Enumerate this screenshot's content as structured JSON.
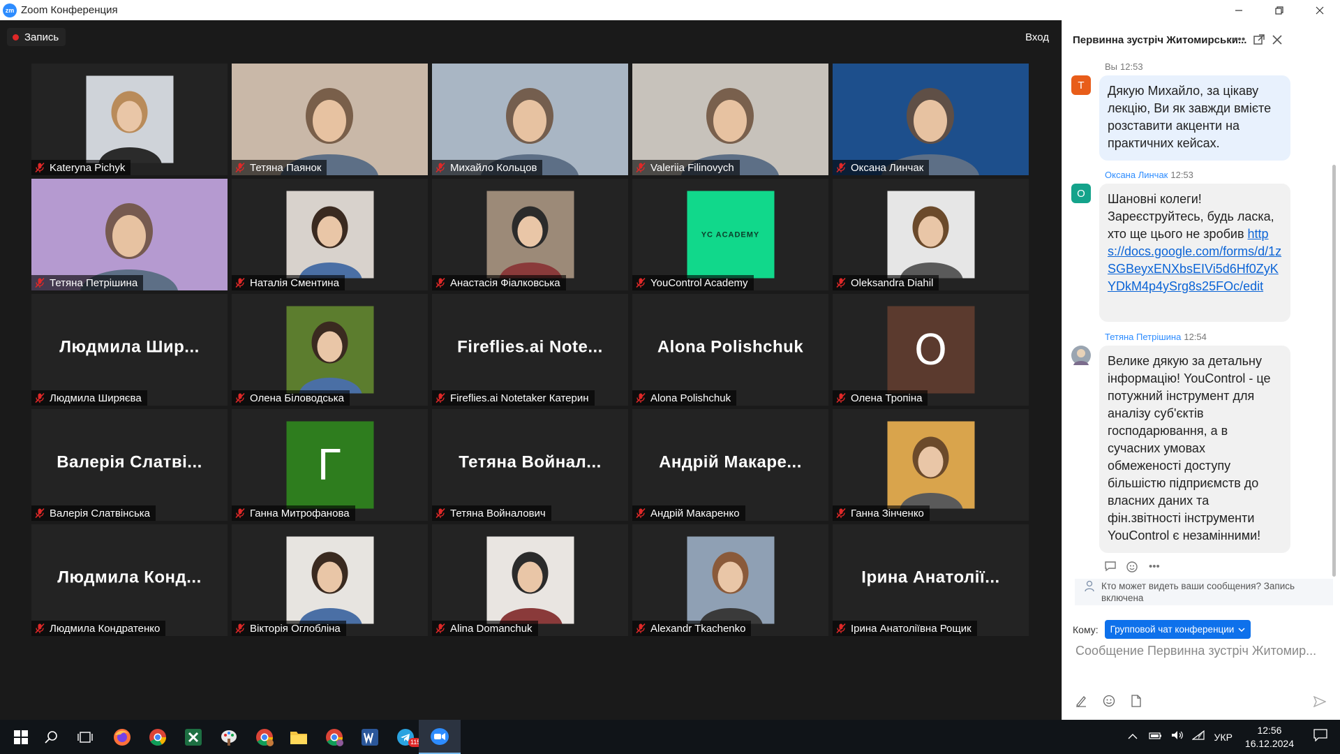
{
  "window": {
    "title": "Zoom Конференция",
    "logo_text": "zm"
  },
  "meeting": {
    "record_label": "Запись",
    "exit_label": "Вход"
  },
  "participants": [
    {
      "name": "Kateryna Pichyk",
      "kind": "photo",
      "bg": "#cfd3d9"
    },
    {
      "name": "Тетяна Паянок",
      "kind": "video",
      "bg": "#c9b8a8"
    },
    {
      "name": "Михайло Кольцов",
      "kind": "video",
      "bg": "#a9b6c4",
      "active": true
    },
    {
      "name": "Valeriia Filinovych",
      "kind": "video",
      "bg": "#c7c2bb"
    },
    {
      "name": "Оксана Линчак",
      "kind": "video",
      "bg": "#1d4f8c"
    },
    {
      "name": "Тетяна Петрішина",
      "kind": "video",
      "bg": "#b59ad0"
    },
    {
      "name": "Наталія Сментина",
      "kind": "photo",
      "bg": "#d8d2cc"
    },
    {
      "name": "Анастасія Фіалковська",
      "kind": "photo",
      "bg": "#9c8a78"
    },
    {
      "name": "YouControl Academy",
      "kind": "logo",
      "bg": "#11d88b",
      "logo_text": "YC ACADEMY"
    },
    {
      "name": "Oleksandra Diahil",
      "kind": "photo",
      "bg": "#e6e6e6"
    },
    {
      "name": "Людмила Ширяєва",
      "kind": "name",
      "display": "Людмила Шир..."
    },
    {
      "name": "Олена Біловодська",
      "kind": "photo",
      "bg": "#5c7d2e"
    },
    {
      "name": "Fireflies.ai Notetaker Катерин",
      "kind": "name",
      "display": "Fireflies.ai Note..."
    },
    {
      "name": "Alona Polishchuk",
      "kind": "name",
      "display": "Alona Polishchuk"
    },
    {
      "name": "Олена Тропіна",
      "kind": "letter",
      "bg": "#5b3a2e",
      "letter": "О"
    },
    {
      "name": "Валерія Слатвінська",
      "kind": "name",
      "display": "Валерія Слатві..."
    },
    {
      "name": "Ганна Митрофанова",
      "kind": "letter",
      "bg": "#2e7d1e",
      "letter": "Г"
    },
    {
      "name": "Тетяна Войналович",
      "kind": "name",
      "display": "Тетяна Войнал..."
    },
    {
      "name": "Андрій Макаренко",
      "kind": "name",
      "display": "Андрій Макаре..."
    },
    {
      "name": "Ганна Зінченко",
      "kind": "photo",
      "bg": "#d9a44c"
    },
    {
      "name": "Людмила Кондратенко",
      "kind": "name",
      "display": "Людмила Конд..."
    },
    {
      "name": "Вікторія Оглобліна",
      "kind": "photo",
      "bg": "#e7e4e0"
    },
    {
      "name": "Alina Domanchuk",
      "kind": "photo",
      "bg": "#e9e5e1"
    },
    {
      "name": "Alexandr Tkachenko",
      "kind": "photo",
      "bg": "#8fa0b4"
    },
    {
      "name": "Ірина Анатоліївна Рощик",
      "kind": "name",
      "display": "Ірина Анатолії..."
    }
  ],
  "chat": {
    "title": "Первинна зустріч Житомирськи...",
    "messages": [
      {
        "sender": "Вы",
        "time": "12:53",
        "avatar": "T",
        "avatar_color": "#e85d1a",
        "self": true,
        "text": "Дякую Михайло, за цікаву лекцію, Ви як завжди вмієте розставити акценти на практичних кейсах."
      },
      {
        "sender": "Оксана Линчак",
        "time": "12:53",
        "avatar": "O",
        "avatar_color": "#14a38b",
        "self": false,
        "text": "Шановні колеги! Зареєструйтесь, будь ласка, хто ще цього не зробив",
        "link": "https://docs.google.com/forms/d/1zSGBeyxENXbsEIVi5d6Hf0ZyKYDkM4p4ySrg8s25FOc/edit"
      },
      {
        "sender": "Тетяна Петрішина",
        "time": "12:54",
        "avatar": "",
        "avatar_color": "#9aa5b1",
        "self": false,
        "text": "Велике дякую за детальну інформацію! YouControl - це потужний інструмент для аналізу суб'єктів господарювання, а в сучасних умовах обмеженості доступу більшістю підприємств до власних даних та фін.звітності інструменти YouControl є незамінними!"
      }
    ],
    "privacy_text": "Кто может видеть ваши сообщения? Запись включена",
    "to_label": "Кому:",
    "to_value": "Групповой чат конференции",
    "compose_placeholder": "Сообщение Первинна зустріч Житомир..."
  },
  "taskbar": {
    "apps": [
      "windows-start",
      "search",
      "task-view",
      "firefox",
      "chrome",
      "excel",
      "paint",
      "chrome-profile",
      "file-explorer",
      "chrome-profile-2",
      "word",
      "telegram",
      "zoom"
    ],
    "telegram_badge": "115",
    "language": "УКР",
    "time": "12:56",
    "date": "16.12.2024"
  }
}
